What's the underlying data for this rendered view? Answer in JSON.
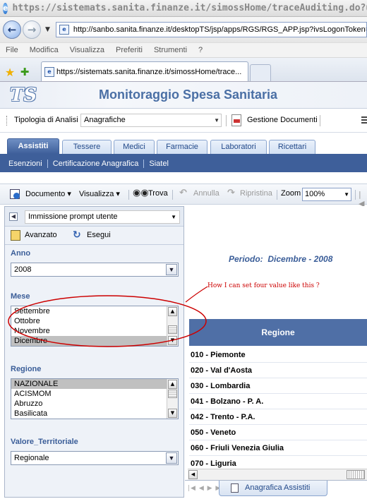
{
  "window": {
    "title": "https://sistemats.sanita.finanze.it/simossHome/traceAuditing.do?url=http://san"
  },
  "browser": {
    "address": "http://sanbo.sanita.finanze.it/desktopTS/jsp/apps/RGS/RGS_APP.jsp?ivsLogonToken=",
    "menu": [
      "File",
      "Modifica",
      "Visualizza",
      "Preferiti",
      "Strumenti",
      "?"
    ],
    "tab_title": "https://sistemats.sanita.finanze.it/simossHome/trace...",
    "icons": {
      "back": "back-arrow-icon",
      "forward": "forward-arrow-icon",
      "favorites": "star-icon",
      "add_favorite": "add-favorite-icon",
      "page": "page-icon"
    }
  },
  "app": {
    "title": "Monitoraggio Spesa Sanitaria",
    "logo_text": "TS",
    "accent_color": "#3e5f9a",
    "header_title_color": "#4a6fa5"
  },
  "analysis_bar": {
    "label": "Tipologia di Analisi",
    "selected": "Anagrafiche",
    "documents_label": "Gestione Documenti"
  },
  "module_tabs": [
    "Assistiti",
    "Tessere",
    "Medici",
    "Farmacie",
    "Laboratori",
    "Ricettari"
  ],
  "active_tab": "Assistiti",
  "subnav": [
    "Esenzioni",
    "Certificazione Anagrafica",
    "Siatel"
  ],
  "toolbar": {
    "documento": "Documento",
    "visualizza": "Visualizza",
    "trova": "Trova",
    "annulla": "Annulla",
    "ripristina": "Ripristina",
    "zoom_label": "Zoom",
    "zoom_value": "100%"
  },
  "prompt_panel": {
    "mode": "Immissione prompt utente",
    "avanzato": "Avanzato",
    "esegui": "Esegui",
    "anno": {
      "label": "Anno",
      "value": "2008"
    },
    "mese": {
      "label": "Mese",
      "items": [
        "Settembre",
        "Ottobre",
        "Novembre",
        "Dicembre"
      ],
      "selected_index": 3
    },
    "regione": {
      "label": "Regione",
      "items": [
        "NAZIONALE",
        "ACISMOM",
        "Abruzzo",
        "Basilicata"
      ],
      "selected_index": 0
    },
    "valore_territoriale": {
      "label": "Valore_Territoriale",
      "value": "Regionale"
    }
  },
  "report": {
    "periodo_label": "Periodo:",
    "periodo_value": "Dicembre - 2008",
    "column_header": "Regione",
    "rows": [
      "010 - Piemonte",
      "020 - Val d'Aosta",
      "030 - Lombardia",
      "041 - Bolzano - P. A.",
      "042 - Trento -  P.A.",
      "050 - Veneto",
      "060 - Friuli Venezia Giulia",
      "070 - Liguria"
    ]
  },
  "sheet_tab": "Anagrafica Assistiti",
  "annotation": {
    "text": "How I can set four value like this ?",
    "color": "#cc0000"
  }
}
